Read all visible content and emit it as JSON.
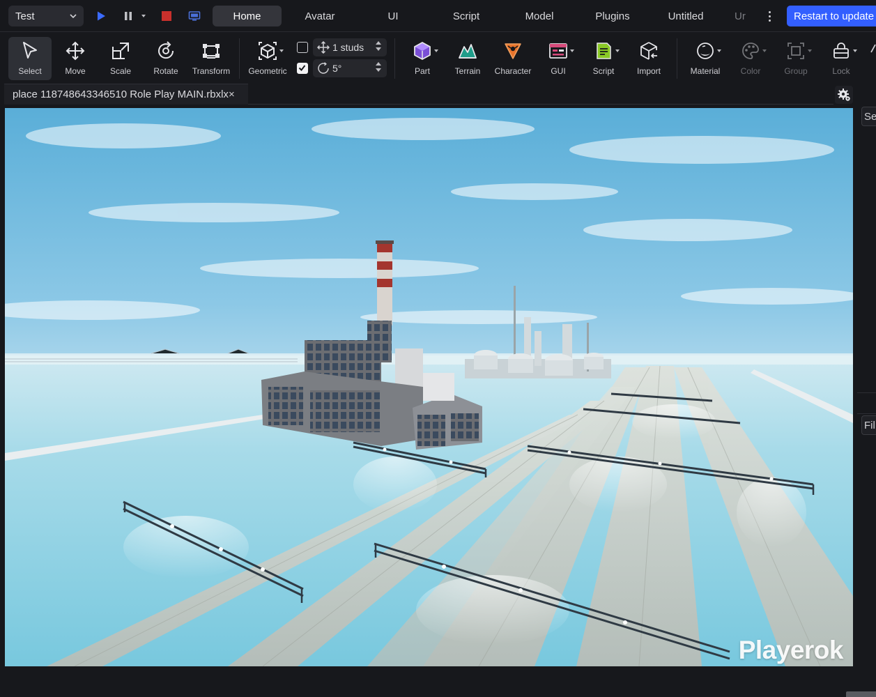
{
  "topbar": {
    "mode_select": {
      "value": "Test",
      "icon": "chevron-down-icon"
    },
    "play_controls": [
      {
        "name": "play",
        "icon": "play-icon",
        "color": "#3b6bff"
      },
      {
        "name": "pause",
        "icon": "pause-icon"
      },
      {
        "name": "stop",
        "icon": "stop-icon",
        "color": "#c9302c"
      },
      {
        "name": "device",
        "icon": "monitor-icon"
      }
    ],
    "tabs": [
      {
        "label": "Home",
        "active": true
      },
      {
        "label": "Avatar"
      },
      {
        "label": "UI"
      },
      {
        "label": "Script"
      },
      {
        "label": "Model"
      },
      {
        "label": "Plugins"
      },
      {
        "label": "Untitled"
      },
      {
        "label": "Ur"
      }
    ],
    "restart_button": "Restart to update",
    "accent_color": "#335fff"
  },
  "ribbon": {
    "tools": [
      {
        "label": "Select",
        "icon": "cursor-icon",
        "active": true
      },
      {
        "label": "Move",
        "icon": "move-arrows-icon"
      },
      {
        "label": "Scale",
        "icon": "scale-icon"
      },
      {
        "label": "Rotate",
        "icon": "rotate-icon"
      },
      {
        "label": "Transform",
        "icon": "transform-icon"
      },
      {
        "label": "Geometric",
        "icon": "geometric-cube-icon"
      },
      {
        "label": "Part",
        "icon": "part-cube-icon"
      },
      {
        "label": "Terrain",
        "icon": "terrain-icon"
      },
      {
        "label": "Character",
        "icon": "character-icon"
      },
      {
        "label": "GUI",
        "icon": "gui-icon"
      },
      {
        "label": "Script",
        "icon": "script-icon"
      },
      {
        "label": "Import",
        "icon": "import-icon"
      },
      {
        "label": "Material",
        "icon": "material-icon"
      },
      {
        "label": "Color",
        "icon": "color-palette-icon",
        "disabled": true
      },
      {
        "label": "Group",
        "icon": "group-icon",
        "disabled": true
      },
      {
        "label": "Lock",
        "icon": "lock-icon",
        "disabled": true
      }
    ],
    "snapping": {
      "move_snap": {
        "enabled": false,
        "value": "1 studs"
      },
      "rotate_snap": {
        "enabled": true,
        "value": "5°"
      }
    }
  },
  "document": {
    "tab_title": "place 118748643346510 Role Play MAIN.rbxlx",
    "close_glyph": "×"
  },
  "viewport": {
    "watermark": "Playerok"
  },
  "side_panel": {
    "search_stub": "Se",
    "filter_stub": "Fil"
  }
}
